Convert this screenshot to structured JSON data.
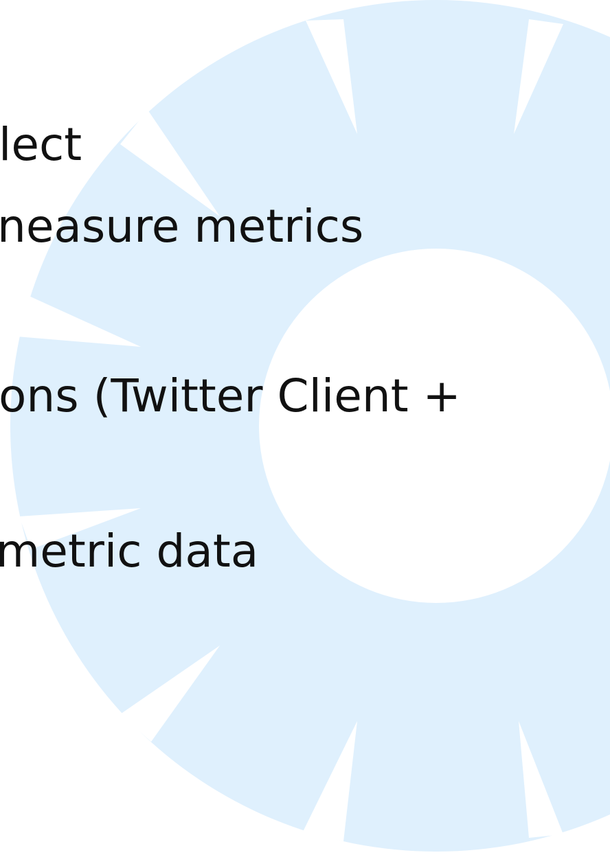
{
  "slide": {
    "lines": [
      "lect",
      "neasure metrics",
      "ons (Twitter Client +",
      "metric data"
    ]
  },
  "colors": {
    "background": "#ffffff",
    "watermark": "#dff0fd",
    "text": "#111111"
  },
  "icons": {
    "watermark": "gear-wheel-icon"
  }
}
